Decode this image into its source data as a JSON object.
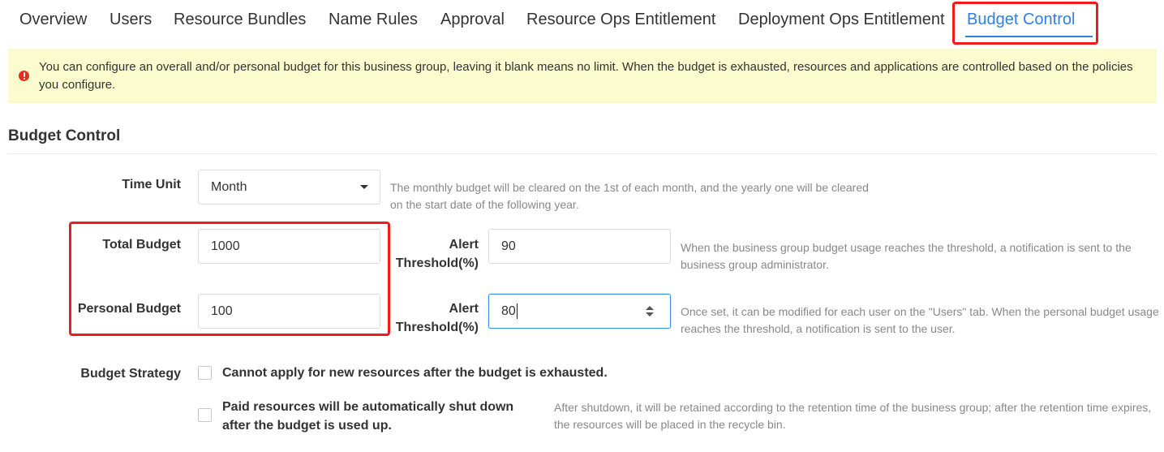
{
  "tabs": [
    {
      "label": "Overview"
    },
    {
      "label": "Users"
    },
    {
      "label": "Resource Bundles"
    },
    {
      "label": "Name Rules"
    },
    {
      "label": "Approval"
    },
    {
      "label": "Resource Ops Entitlement"
    },
    {
      "label": "Deployment Ops Entitlement"
    },
    {
      "label": "Budget Control",
      "active": true
    }
  ],
  "notice": {
    "text": "You can configure an overall and/or personal budget for this business group, leaving it blank means no limit. When the budget is exhausted, resources and applications are controlled based on the policies you configure."
  },
  "section": {
    "title": "Budget Control"
  },
  "time_unit": {
    "label": "Time Unit",
    "value": "Month",
    "help": "The monthly budget will be cleared on the 1st of each month, and the yearly one will be cleared on the start date of the following year."
  },
  "total_budget": {
    "label": "Total Budget",
    "value": "1000",
    "alert_label": "Alert Threshold(%)",
    "alert_value": "90",
    "help": "When the business group budget usage reaches the threshold, a notification is sent to the business group administrator."
  },
  "personal_budget": {
    "label": "Personal Budget",
    "value": "100",
    "alert_label": "Alert Threshold(%)",
    "alert_value": "80",
    "help": "Once set, it can be modified for each user on the \"Users\" tab. When the personal budget usage reaches the threshold, a notification is sent to the user."
  },
  "budget_strategy": {
    "label": "Budget Strategy",
    "options": [
      {
        "label": "Cannot apply for new resources after the budget is exhausted.",
        "checked": false
      },
      {
        "label": "Paid resources will be automatically shut down after the budget is used up.",
        "checked": false,
        "help": "After shutdown, it will be retained according to the retention time of the business group; after the retention time expires, the resources will be placed in the recycle bin."
      }
    ]
  },
  "colors": {
    "accent": "#2f80e0",
    "notice_bg": "#fbfccd",
    "annotation": "#ee1c1c"
  }
}
